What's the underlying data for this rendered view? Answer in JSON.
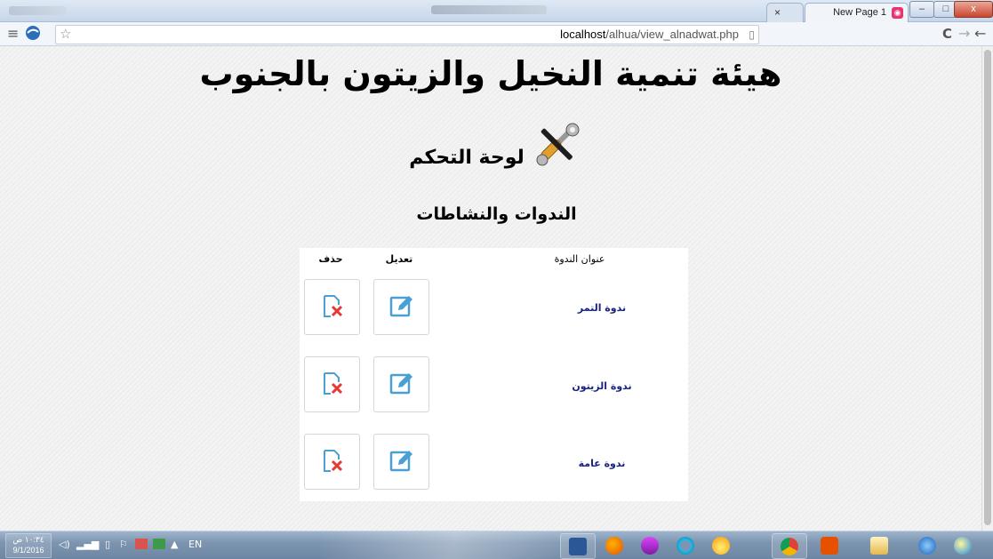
{
  "browser": {
    "tabs": [
      {
        "title": "New Page 1",
        "close_label": "×",
        "favicon": "globe-icon"
      }
    ],
    "window_controls": {
      "minimize": "–",
      "maximize": "□",
      "close": "x"
    },
    "address_bar": {
      "url_host": "localhost",
      "url_path": "/alhua/view_alnadwat.php"
    },
    "toolbar_icons": [
      "menu-icon",
      "extension-globe-icon",
      "star-icon",
      "page-icon",
      "reload-icon",
      "forward-icon",
      "back-icon"
    ]
  },
  "page": {
    "site_title": "هيئة تنمية النخيل والزيتون بالجنوب",
    "panel_title": "لوحة التحكم",
    "section_title": "الندوات والنشاطات",
    "table": {
      "headers": {
        "title": "عنوان الندوة",
        "edit": "تعديل",
        "delete": "حذف"
      },
      "rows": [
        {
          "title": "ندوة التمر"
        },
        {
          "title": "ندوة الزيتون"
        },
        {
          "title": "ندوة عامة"
        }
      ]
    }
  },
  "taskbar": {
    "clock_time": "١٠:٣٤ ص",
    "clock_date": "9/1/2016",
    "language": "EN",
    "apps": [
      "word-icon",
      "firefox-icon",
      "app-s-icon",
      "ring-icon",
      "chrome-alt-icon",
      "chrome-icon",
      "media-player-icon",
      "file-explorer-icon",
      "ie-icon",
      "opera-icon"
    ]
  },
  "colors": {
    "row_title": "#1a237e",
    "edit_icon": "#4a9fd5",
    "delete_x": "#e53935",
    "delete_page": "#4a9fd5"
  }
}
